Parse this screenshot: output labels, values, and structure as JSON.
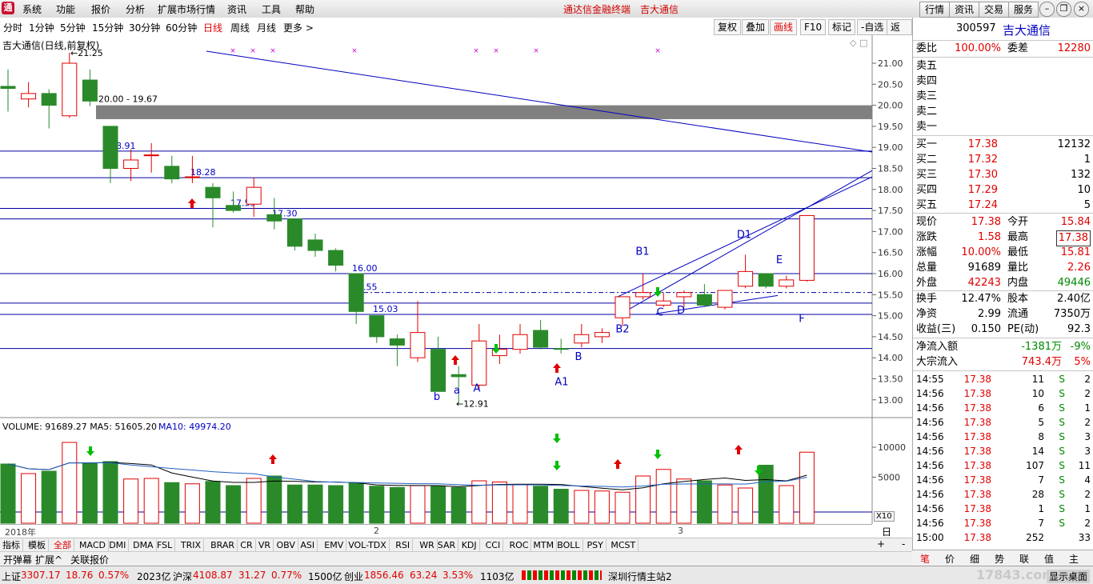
{
  "menu": {
    "items": [
      "系统",
      "功能",
      "报价",
      "分析",
      "扩展市场行情",
      "资讯",
      "工具",
      "帮助"
    ],
    "title1": "通达信金融终端",
    "title2": "吉大通信",
    "right_buttons": [
      "行情",
      "资讯",
      "交易",
      "服务"
    ]
  },
  "periods": [
    "分时",
    "1分钟",
    "5分钟",
    "15分钟",
    "30分钟",
    "60分钟",
    "日线",
    "周线",
    "月线",
    "更多 >"
  ],
  "active_period": "日线",
  "tools": [
    "复权",
    "叠加",
    "画线",
    "F10",
    "标记",
    "-自选",
    "返回"
  ],
  "chart": {
    "title": "吉大通信(日线,前复权)",
    "price_ticks": [
      "21.00",
      "20.50",
      "20.00",
      "19.50",
      "19.00",
      "18.50",
      "18.00",
      "17.50",
      "17.00",
      "16.50",
      "16.00",
      "15.50",
      "15.00",
      "14.50",
      "14.00",
      "13.50",
      "13.00"
    ],
    "high_label": "21.25",
    "low_label": "12.91",
    "zone_label": "20.00 - 19.67",
    "level_labels": [
      "18.91",
      "18.28",
      "17.55",
      "17.30",
      "16.00",
      "15.55",
      "15.03"
    ],
    "pattern_labels": [
      "b",
      "a",
      "A",
      "A1",
      "B",
      "B1",
      "B2",
      "C",
      "D",
      "D1",
      "E",
      "F"
    ],
    "volume_header": "VOLUME: 91689.27  MA5: 51605.20",
    "volume_ma10": "MA10: 49974.20",
    "volume_ticks": [
      "10000",
      "5000"
    ],
    "volume_unit": "X10",
    "dates": [
      "2018年",
      "2",
      "3"
    ],
    "period_label": "日线"
  },
  "chart_data": {
    "type": "candlestick",
    "title": "吉大通信(日线,前复权)",
    "candles": [
      {
        "o": 20.45,
        "c": 20.4,
        "h": 20.85,
        "l": 19.85
      },
      {
        "o": 20.15,
        "c": 20.28,
        "h": 20.55,
        "l": 19.95
      },
      {
        "o": 20.28,
        "c": 20.0,
        "h": 20.38,
        "l": 19.45
      },
      {
        "o": 19.75,
        "c": 21.0,
        "h": 21.25,
        "l": 19.7
      },
      {
        "o": 20.6,
        "c": 20.1,
        "h": 20.85,
        "l": 19.98
      },
      {
        "o": 19.5,
        "c": 18.5,
        "h": 19.5,
        "l": 18.15
      },
      {
        "o": 18.5,
        "c": 18.7,
        "h": 18.95,
        "l": 18.2
      },
      {
        "o": 18.82,
        "c": 18.82,
        "h": 19.1,
        "l": 18.4
      },
      {
        "o": 18.55,
        "c": 18.25,
        "h": 18.8,
        "l": 18.15
      },
      {
        "o": 18.3,
        "c": 18.3,
        "h": 18.8,
        "l": 18.15
      },
      {
        "o": 18.05,
        "c": 17.8,
        "h": 18.15,
        "l": 17.1
      },
      {
        "o": 17.62,
        "c": 17.5,
        "h": 17.95,
        "l": 17.45
      },
      {
        "o": 17.65,
        "c": 18.05,
        "h": 18.28,
        "l": 17.35
      },
      {
        "o": 17.4,
        "c": 17.25,
        "h": 17.8,
        "l": 17.05
      },
      {
        "o": 17.3,
        "c": 16.65,
        "h": 17.3,
        "l": 16.55
      },
      {
        "o": 16.8,
        "c": 16.55,
        "h": 16.95,
        "l": 16.4
      },
      {
        "o": 16.55,
        "c": 16.2,
        "h": 16.6,
        "l": 16.05
      },
      {
        "o": 16.0,
        "c": 15.1,
        "h": 16.0,
        "l": 14.8
      },
      {
        "o": 15.0,
        "c": 14.5,
        "h": 15.0,
        "l": 14.35
      },
      {
        "o": 14.45,
        "c": 14.3,
        "h": 14.55,
        "l": 13.8
      },
      {
        "o": 14.0,
        "c": 14.6,
        "h": 15.35,
        "l": 13.9
      },
      {
        "o": 14.2,
        "c": 13.2,
        "h": 14.5,
        "l": 13.2
      },
      {
        "o": 13.6,
        "c": 13.55,
        "h": 13.8,
        "l": 12.91
      },
      {
        "o": 13.35,
        "c": 14.4,
        "h": 14.8,
        "l": 13.25
      },
      {
        "o": 14.05,
        "c": 14.2,
        "h": 14.55,
        "l": 13.85
      },
      {
        "o": 14.2,
        "c": 14.55,
        "h": 14.8,
        "l": 14.1
      },
      {
        "o": 14.65,
        "c": 14.25,
        "h": 14.9,
        "l": 14.2
      },
      {
        "o": 14.22,
        "c": 14.2,
        "h": 14.45,
        "l": 14.1
      },
      {
        "o": 14.35,
        "c": 14.55,
        "h": 14.8,
        "l": 14.25
      },
      {
        "o": 14.5,
        "c": 14.6,
        "h": 14.7,
        "l": 14.35
      },
      {
        "o": 14.95,
        "c": 15.45,
        "h": 15.45,
        "l": 14.75
      },
      {
        "o": 15.45,
        "c": 15.55,
        "h": 16.0,
        "l": 15.38
      },
      {
        "o": 15.25,
        "c": 15.35,
        "h": 15.55,
        "l": 15.2
      },
      {
        "o": 15.45,
        "c": 15.55,
        "h": 15.6,
        "l": 15.2
      },
      {
        "o": 15.5,
        "c": 15.25,
        "h": 15.75,
        "l": 15.2
      },
      {
        "o": 15.2,
        "c": 15.6,
        "h": 15.6,
        "l": 15.15
      },
      {
        "o": 15.7,
        "c": 16.05,
        "h": 16.45,
        "l": 15.65
      },
      {
        "o": 16.0,
        "c": 15.7,
        "h": 16.0,
        "l": 15.65
      },
      {
        "o": 15.7,
        "c": 15.85,
        "h": 15.95,
        "l": 15.65
      },
      {
        "o": 15.84,
        "c": 17.38,
        "h": 17.38,
        "l": 15.81
      }
    ],
    "volume_x10": [
      7200,
      5600,
      6000,
      10800,
      7300,
      7600,
      4700,
      4800,
      4100,
      3900,
      4300,
      3600,
      4800,
      5200,
      3700,
      3700,
      3600,
      4100,
      3500,
      3300,
      3600,
      3500,
      3300,
      4400,
      4200,
      3800,
      3500,
      3000,
      2800,
      2700,
      2500,
      5200,
      6300,
      4700,
      4400,
      3700,
      3200,
      7000,
      3600,
      9169
    ]
  },
  "right": {
    "code": "300597",
    "name": "吉大通信",
    "wb": {
      "label": "委比",
      "value": "100.00%",
      "label2": "委差",
      "value2": "12280"
    },
    "sells": [
      {
        "l": "卖五",
        "p": "",
        "v": ""
      },
      {
        "l": "卖四",
        "p": "",
        "v": ""
      },
      {
        "l": "卖三",
        "p": "",
        "v": ""
      },
      {
        "l": "卖二",
        "p": "",
        "v": ""
      },
      {
        "l": "卖一",
        "p": "",
        "v": ""
      }
    ],
    "buys": [
      {
        "l": "买一",
        "p": "17.38",
        "v": "12132"
      },
      {
        "l": "买二",
        "p": "17.32",
        "v": "1"
      },
      {
        "l": "买三",
        "p": "17.30",
        "v": "132"
      },
      {
        "l": "买四",
        "p": "17.29",
        "v": "10"
      },
      {
        "l": "买五",
        "p": "17.24",
        "v": "5"
      }
    ],
    "stats": [
      {
        "l1": "现价",
        "v1": "17.38",
        "c1": "red",
        "l2": "今开",
        "v2": "15.84",
        "c2": "red"
      },
      {
        "l1": "涨跌",
        "v1": "1.58",
        "c1": "red",
        "l2": "最高",
        "v2": "17.38",
        "c2": "red"
      },
      {
        "l1": "涨幅",
        "v1": "10.00%",
        "c1": "red",
        "l2": "最低",
        "v2": "15.81",
        "c2": "red"
      },
      {
        "l1": "总量",
        "v1": "91689",
        "c1": "",
        "l2": "量比",
        "v2": "2.26",
        "c2": "red"
      },
      {
        "l1": "外盘",
        "v1": "42243",
        "c1": "red",
        "l2": "内盘",
        "v2": "49446",
        "c2": "green"
      }
    ],
    "stats2": [
      {
        "l1": "换手",
        "v1": "12.47%",
        "l2": "股本",
        "v2": "2.40亿"
      },
      {
        "l1": "净资",
        "v1": "2.99",
        "l2": "流通",
        "v2": "7350万"
      },
      {
        "l1": "收益(三)",
        "v1": "0.150",
        "l2": "PE(动)",
        "v2": "92.3"
      }
    ],
    "flows": [
      {
        "l": "净流入额",
        "v": "-1381万",
        "p": "-9%",
        "c": "green"
      },
      {
        "l": "大宗流入",
        "v": "743.4万",
        "p": "5%",
        "c": "red"
      }
    ],
    "ticks": [
      {
        "t": "14:55",
        "p": "17.38",
        "v": "11",
        "s": "S",
        "n": "2"
      },
      {
        "t": "14:56",
        "p": "17.38",
        "v": "10",
        "s": "S",
        "n": "2"
      },
      {
        "t": "14:56",
        "p": "17.38",
        "v": "6",
        "s": "S",
        "n": "1"
      },
      {
        "t": "14:56",
        "p": "17.38",
        "v": "5",
        "s": "S",
        "n": "2"
      },
      {
        "t": "14:56",
        "p": "17.38",
        "v": "8",
        "s": "S",
        "n": "3"
      },
      {
        "t": "14:56",
        "p": "17.38",
        "v": "14",
        "s": "S",
        "n": "3"
      },
      {
        "t": "14:56",
        "p": "17.38",
        "v": "107",
        "s": "S",
        "n": "11"
      },
      {
        "t": "14:56",
        "p": "17.38",
        "v": "7",
        "s": "S",
        "n": "4"
      },
      {
        "t": "14:56",
        "p": "17.38",
        "v": "28",
        "s": "S",
        "n": "2"
      },
      {
        "t": "14:56",
        "p": "17.38",
        "v": "1",
        "s": "S",
        "n": "1"
      },
      {
        "t": "14:56",
        "p": "17.38",
        "v": "7",
        "s": "S",
        "n": "2"
      },
      {
        "t": "15:00",
        "p": "17.38",
        "v": "252",
        "s": "",
        "n": "33"
      }
    ],
    "tabs": [
      "笔",
      "价",
      "细",
      "势",
      "联",
      "值",
      "主"
    ]
  },
  "indicators": [
    "指标",
    "模板",
    "全部",
    "MACD",
    "DMI",
    "DMA",
    "FSL",
    "TRIX",
    "BRAR",
    "CR",
    "VR",
    "OBV",
    "ASI",
    "EMV",
    "VOL-TDX",
    "RSI",
    "WR",
    "SAR",
    "KDJ",
    "CCI",
    "ROC",
    "MTM",
    "BOLL",
    "PSY",
    "MCST"
  ],
  "subtabs": [
    "开弹幕",
    "扩展^",
    "关联报价"
  ],
  "status": {
    "sh_label": "上证",
    "sh_val": "3307.17",
    "sh_chg": "18.76",
    "sh_pct": "0.57%",
    "sh_amt": "2023亿",
    "sz_label": "沪深",
    "sz_val": "4108.87",
    "sz_chg": "31.27",
    "sz_pct": "0.77%",
    "sz_amt": "1500亿",
    "cy_label": "创业",
    "cy_val": "1856.46",
    "cy_chg": "63.24",
    "cy_pct": "3.53%",
    "cy_amt": "1103亿",
    "server": "深圳行情主站2",
    "desktop": "显示桌面",
    "watermark": "17843.com"
  }
}
